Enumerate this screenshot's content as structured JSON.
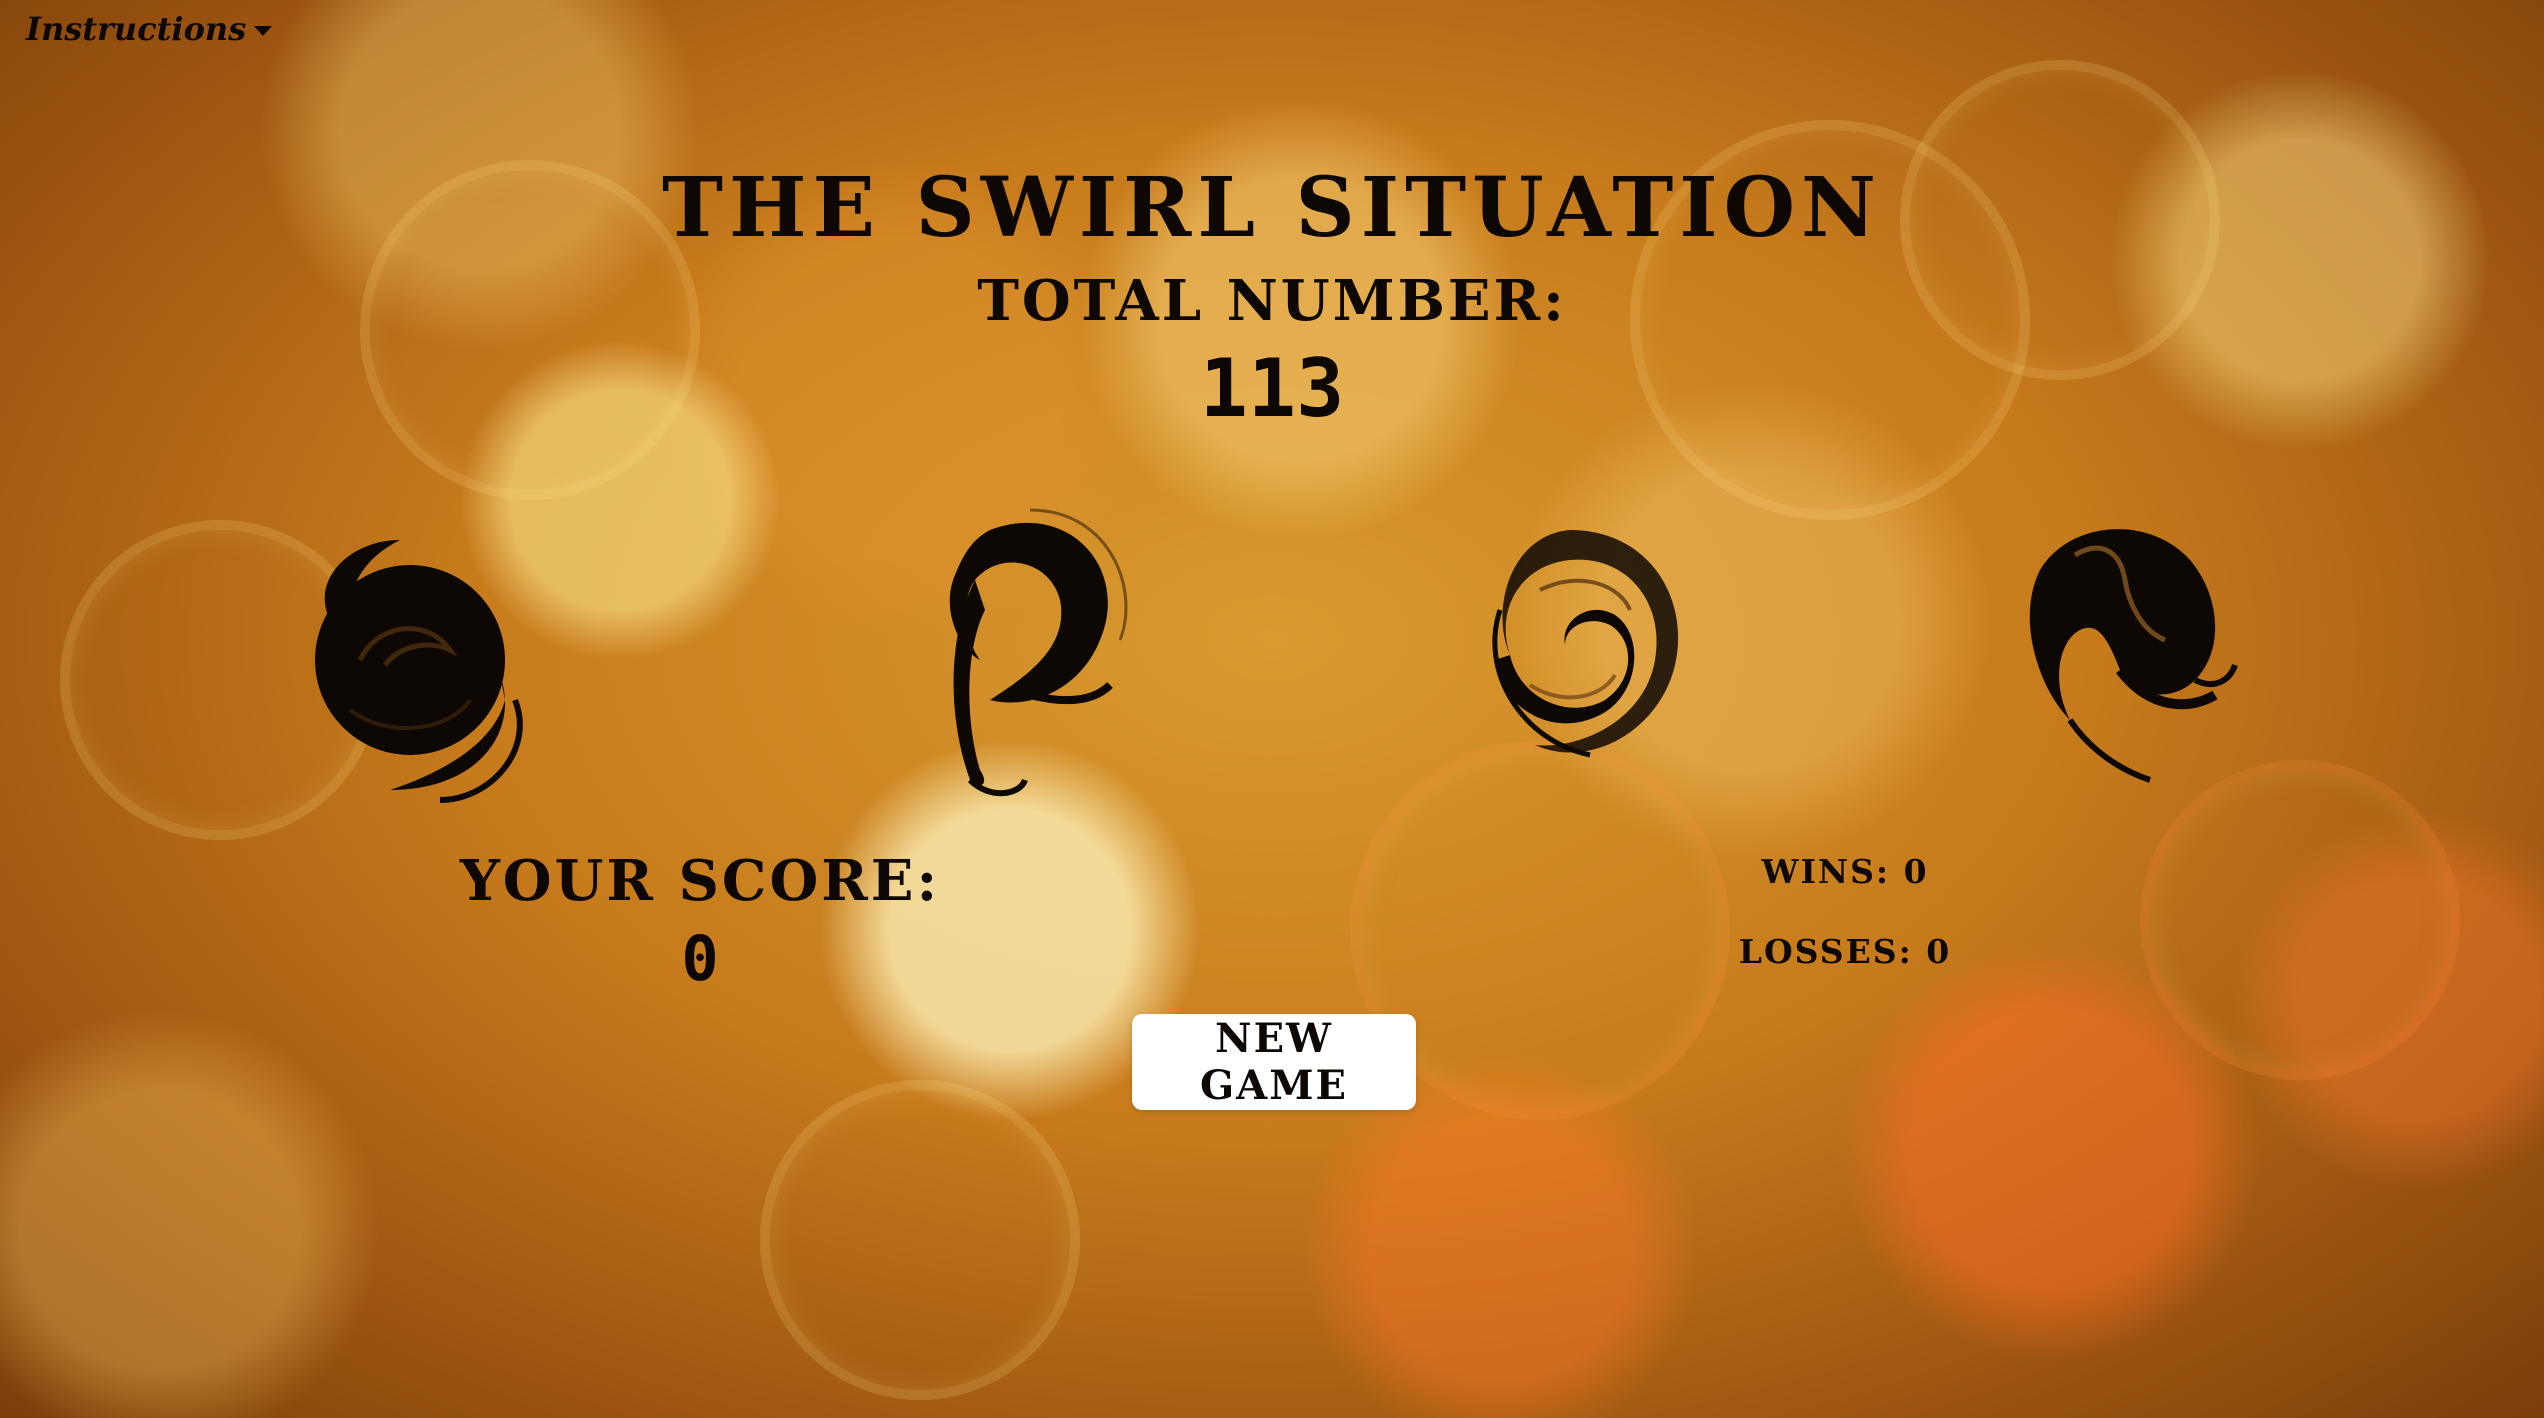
{
  "nav": {
    "instructions_label": "Instructions"
  },
  "header": {
    "title": "The Swirl Situation",
    "total_label": "Total Number:",
    "total_value": "113"
  },
  "crystals": [
    {
      "name": "swirl-1"
    },
    {
      "name": "swirl-2"
    },
    {
      "name": "swirl-3"
    },
    {
      "name": "swirl-4"
    }
  ],
  "score": {
    "label": "Your Score:",
    "value": "0"
  },
  "record": {
    "wins": "Wins: 0",
    "losses": "Losses: 0"
  },
  "controls": {
    "new_game_label": "New Game"
  },
  "colors": {
    "ink": "#0d0804",
    "button_bg": "#ffffff",
    "background_gold": "#c77b1c"
  }
}
